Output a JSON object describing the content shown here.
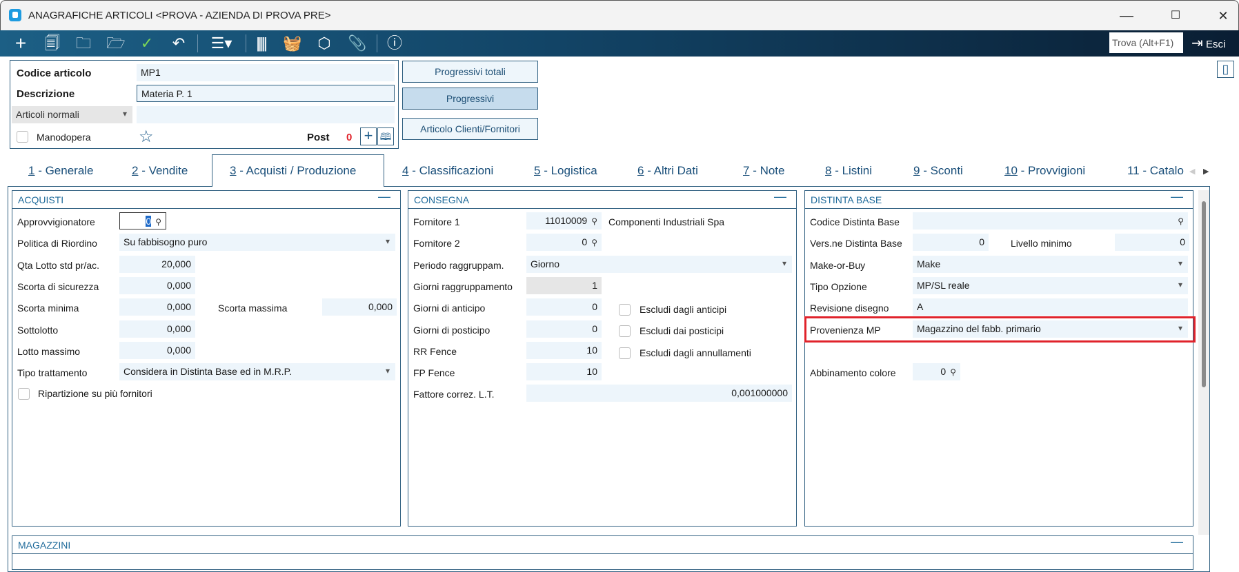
{
  "window": {
    "title": "ANAGRAFICHE ARTICOLI <PROVA - AZIENDA DI PROVA PRE>",
    "minimize": "—",
    "maximize": "☐",
    "close": "✕"
  },
  "toolbar": {
    "find_placeholder": "Trova (Alt+F1)",
    "exit_label": "Esci"
  },
  "header": {
    "code_label": "Codice articolo",
    "code_value": "MP1",
    "desc_label": "Descrizione",
    "desc_value": "Materia P. 1",
    "type_value": "Articoli normali",
    "labor_label": "Manodopera",
    "post_label": "Post",
    "post_count": "0"
  },
  "buttons": {
    "total_progressives": "Progressivi totali",
    "progressives": "Progressivi",
    "client_supplier_item": "Articolo Clienti/Fornitori"
  },
  "tabs": [
    {
      "num": "1",
      "label": " - Generale"
    },
    {
      "num": "2",
      "label": " - Vendite"
    },
    {
      "num": "3",
      "label": " - Acquisti / Produzione"
    },
    {
      "num": "4",
      "label": " - Classificazioni"
    },
    {
      "num": "5",
      "label": " - Logistica"
    },
    {
      "num": "6",
      "label": " - Altri Dati"
    },
    {
      "num": "7",
      "label": " - Note"
    },
    {
      "num": "8",
      "label": " - Listini"
    },
    {
      "num": "9",
      "label": " - Sconti"
    },
    {
      "num": "10",
      "label": " - Provvigioni"
    },
    {
      "num": "11",
      "label": " - Catalo"
    }
  ],
  "acquisti": {
    "title": "ACQUISTI",
    "approvvigionatore_label": "Approvvigionatore",
    "approvvigionatore": "0",
    "politica_label": "Politica di Riordino",
    "politica": "Su fabbisogno puro",
    "qta_label": "Qta Lotto std pr/ac.",
    "qta": "20,000",
    "scorta_sic_label": "Scorta di sicurezza",
    "scorta_sic": "0,000",
    "scorta_min_label": "Scorta minima",
    "scorta_min": "0,000",
    "scorta_max_label": "Scorta massima",
    "scorta_max": "0,000",
    "sottolotto_label": "Sottolotto",
    "sottolotto": "0,000",
    "lotto_max_label": "Lotto massimo",
    "lotto_max": "0,000",
    "tipo_label": "Tipo trattamento",
    "tipo": "Considera in Distinta Base ed in M.R.P.",
    "ripartizione_label": "Ripartizione su più fornitori"
  },
  "consegna": {
    "title": "CONSEGNA",
    "forn1_label": "Fornitore 1",
    "forn1": "11010009",
    "forn1_name": "Componenti Industriali Spa",
    "forn2_label": "Fornitore 2",
    "forn2": "0",
    "periodo_label": "Periodo raggruppam.",
    "periodo": "Giorno",
    "giorni_ragg_label": "Giorni raggruppamento",
    "giorni_ragg": "1",
    "anticipo_label": "Giorni di anticipo",
    "anticipo": "0",
    "posticipo_label": "Giorni di posticipo",
    "posticipo": "0",
    "rr_label": "RR Fence",
    "rr": "10",
    "fp_label": "FP Fence",
    "fp": "10",
    "fattore_label": "Fattore correz. L.T.",
    "fattore": "0,001000000",
    "escl_anticipi": "Escludi dagli anticipi",
    "escl_posticipi": "Escludi dai posticipi",
    "escl_annull": "Escludi dagli annullamenti"
  },
  "distinta": {
    "title": "DISTINTA BASE",
    "codice_label": "Codice Distinta Base",
    "codice": "",
    "vers_label": "Vers.ne Distinta Base",
    "vers": "0",
    "livello_label": "Livello minimo",
    "livello": "0",
    "mob_label": "Make-or-Buy",
    "mob": "Make",
    "opzione_label": "Tipo Opzione",
    "opzione": "MP/SL reale",
    "revisione_label": "Revisione disegno",
    "revisione": "A",
    "provenienza_label": "Provenienza MP",
    "provenienza": "Magazzino del fabb. primario",
    "colore_label": "Abbinamento colore",
    "colore": "0"
  },
  "magazzini": {
    "title": "MAGAZZINI"
  },
  "colors": {
    "highlight": "#e0232b",
    "toolbar": "#124466"
  }
}
